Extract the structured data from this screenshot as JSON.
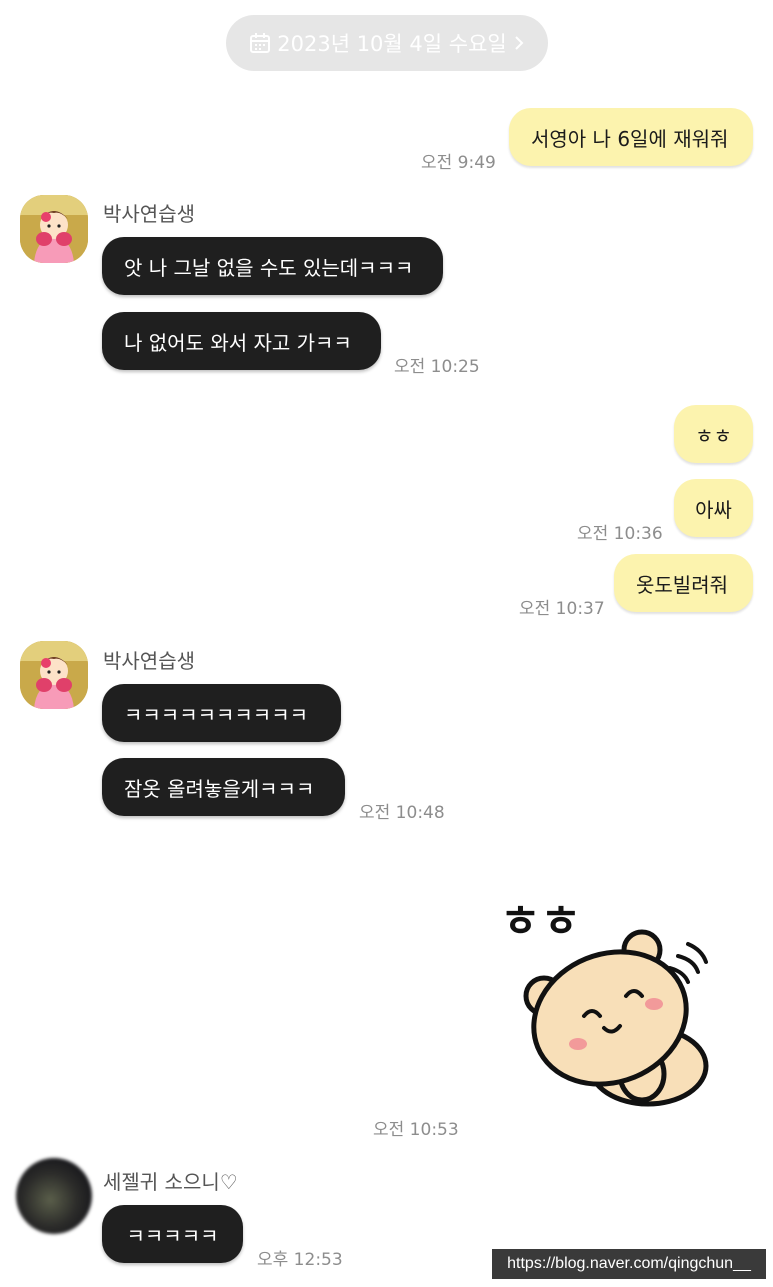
{
  "date_divider": {
    "label": "2023년 10월 4일 수요일",
    "icon": "calendar-icon",
    "chevron": "chevron-right-icon"
  },
  "messages": [
    {
      "text": "서영아 나 6일에 재워줘",
      "time": "오전 9:49"
    },
    {
      "sender": "박사연습생",
      "text": "앗 나 그날 없을 수도 있는데ㅋㅋㅋ"
    },
    {
      "text": "나 없어도 와서 자고 가ㅋㅋ",
      "time": "오전 10:25"
    },
    {
      "text": "ㅎㅎ"
    },
    {
      "text": "아싸",
      "time": "오전 10:36"
    },
    {
      "text": "옷도빌려줘",
      "time": "오전 10:37"
    },
    {
      "sender": "박사연습생",
      "text": "ㅋㅋㅋㅋㅋㅋㅋㅋㅋㅋ"
    },
    {
      "text": "잠옷 올려놓을게ㅋㅋㅋ",
      "time": "오전 10:48"
    },
    {
      "sticker_text": "ㅎㅎ",
      "time": "오전 10:53"
    },
    {
      "sender": "세젤귀 소으니♡",
      "text": "ㅋㅋㅋㅋㅋ",
      "time": "오후 12:53"
    }
  ],
  "watermark": "https://blog.naver.com/qingchun__",
  "colors": {
    "outgoing_bubble": "#fcf3ae",
    "incoming_bubble": "#1f1f1f",
    "date_pill": "#e6e6e6",
    "time_text": "#8d8d8d"
  }
}
